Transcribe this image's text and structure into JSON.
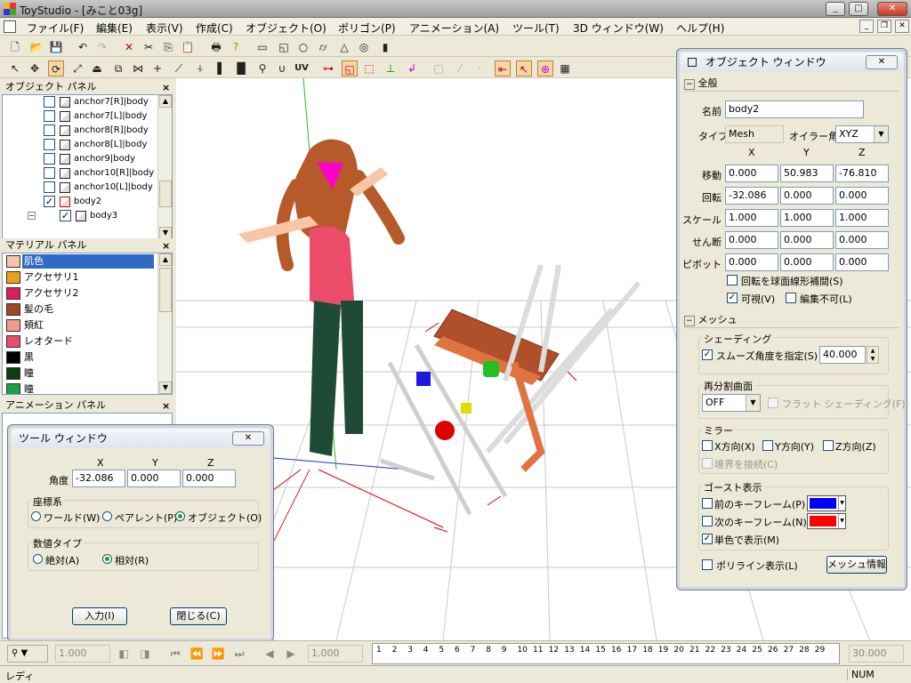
{
  "window": {
    "title": "ToyStudio - [みこと03g]",
    "min": "_",
    "max": "□",
    "close": "✕"
  },
  "menu": [
    "ファイル(F)",
    "編集(E)",
    "表示(V)",
    "作成(C)",
    "オブジェクト(O)",
    "ポリゴン(P)",
    "アニメーション(A)",
    "ツール(T)",
    "3D ウィンドウ(W)",
    "ヘルプ(H)"
  ],
  "object_panel": {
    "title": "オブジェクト パネル",
    "items": [
      {
        "label": "anchor7[R]|body",
        "checked": false,
        "indent": 1
      },
      {
        "label": "anchor7[L]|body",
        "checked": false,
        "indent": 1
      },
      {
        "label": "anchor8[R]|body",
        "checked": false,
        "indent": 1
      },
      {
        "label": "anchor8[L]|body",
        "checked": false,
        "indent": 1
      },
      {
        "label": "anchor9|body",
        "checked": false,
        "indent": 1
      },
      {
        "label": "anchor10[R]|body",
        "checked": false,
        "indent": 1
      },
      {
        "label": "anchor10[L]|body",
        "checked": false,
        "indent": 1
      },
      {
        "label": "body2",
        "checked": true,
        "indent": 1
      },
      {
        "label": "body3",
        "checked": true,
        "indent": 2
      }
    ]
  },
  "material_panel": {
    "title": "マテリアル パネル",
    "items": [
      {
        "label": "肌色",
        "color": "#f6c6a6",
        "selected": true
      },
      {
        "label": "アクセサリ1",
        "color": "#e9a21a"
      },
      {
        "label": "アクセサリ2",
        "color": "#e11a5e"
      },
      {
        "label": "髪の毛",
        "color": "#a0482a"
      },
      {
        "label": "頬紅",
        "color": "#f39a8e"
      },
      {
        "label": "レオタード",
        "color": "#ec4d6a"
      },
      {
        "label": "黒",
        "color": "#000000"
      },
      {
        "label": "瞳",
        "color": "#0c3e12"
      },
      {
        "label": "瞳",
        "color": "#1aa04a"
      }
    ]
  },
  "animation_panel": {
    "title": "アニメーション パネル"
  },
  "tool_window": {
    "title": "ツール ウィンドウ",
    "x_hdr": "X",
    "y_hdr": "Y",
    "z_hdr": "Z",
    "angle_label": "角度",
    "angle": [
      "-32.086",
      "0.000",
      "0.000"
    ],
    "coord_label": "座標系",
    "coord_opts": [
      "ワールド(W)",
      "ペアレント(P)",
      "オブジェクト(O)"
    ],
    "value_label": "数値タイプ",
    "value_opts": [
      "絶対(A)",
      "相対(R)"
    ],
    "input_btn": "入力(I)",
    "close_btn": "閉じる(C)"
  },
  "object_window": {
    "title": "オブジェクト ウィンドウ",
    "general": "全般",
    "name_label": "名前",
    "name": "body2",
    "type_label": "タイプ",
    "type": "Mesh",
    "euler_label": "オイラー角",
    "euler": "XYZ",
    "x_hdr": "X",
    "y_hdr": "Y",
    "z_hdr": "Z",
    "rows": [
      {
        "label": "移動",
        "v": [
          "0.000",
          "50.983",
          "-76.810"
        ]
      },
      {
        "label": "回転",
        "v": [
          "-32.086",
          "0.000",
          "0.000"
        ]
      },
      {
        "label": "スケール",
        "v": [
          "1.000",
          "1.000",
          "1.000"
        ]
      },
      {
        "label": "せん断",
        "v": [
          "0.000",
          "0.000",
          "0.000"
        ]
      },
      {
        "label": "ピボット",
        "v": [
          "0.000",
          "0.000",
          "0.000"
        ]
      }
    ],
    "slerp": "回転を球面線形補間(S)",
    "visible": "可視(V)",
    "locked": "編集不可(L)",
    "mesh": "メッシュ",
    "shading": "シェーディング",
    "smooth": "スムーズ角度を指定(S)",
    "smooth_val": "40.000",
    "subdiv": "再分割曲面",
    "subdiv_val": "OFF",
    "flat": "フラット シェーディング(F)",
    "mirror": "ミラー",
    "mx": "X方向(X)",
    "my": "Y方向(Y)",
    "mz": "Z方向(Z)",
    "connect": "境界を接続(C)",
    "ghost": "ゴースト表示",
    "prev_key": "前のキーフレーム(P)",
    "prev_color": "#0000ff",
    "next_key": "次のキーフレーム(N)",
    "next_color": "#ff0000",
    "mono": "単色で表示(M)",
    "polyline": "ポリライン表示(L)",
    "mesh_info": "メッシュ情報"
  },
  "timeline": {
    "val1": "1.000",
    "val2": "1.000",
    "frames": [
      "1",
      "2",
      "3",
      "4",
      "5",
      "6",
      "7",
      "8",
      "9",
      "10",
      "11",
      "12",
      "13",
      "14",
      "15",
      "16",
      "17",
      "18",
      "19",
      "20",
      "21",
      "22",
      "23",
      "24",
      "25",
      "26",
      "27",
      "28",
      "29"
    ],
    "end": "30.000"
  },
  "status": {
    "left": "レディ",
    "right": "NUM"
  }
}
